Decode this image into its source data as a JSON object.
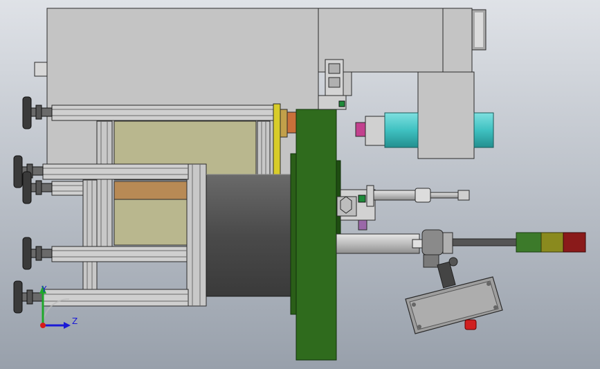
{
  "viewport": {
    "background_top": "#d9dde3",
    "background_bottom": "#9aa2ad"
  },
  "colors": {
    "frame_gray": "#c0c0c0",
    "edge": "#2a2a2a",
    "green_disc": "#2f6b1d",
    "green_dark": "#1f4d12",
    "cylinder_dark": "#4c4c4c",
    "panel_khaki": "#b9b78e",
    "panel_brown": "#b88a55",
    "yellow_plate": "#d8cc2a",
    "copper": "#c8703a",
    "teal": "#3fc1c1",
    "magenta": "#c2418e",
    "tower_green": "#3c7a2a",
    "tower_yellow": "#8a8a1e",
    "tower_red": "#8a1a1a",
    "button_red": "#d02020"
  },
  "triad": {
    "z_label": "Z",
    "y_label": "Y"
  }
}
